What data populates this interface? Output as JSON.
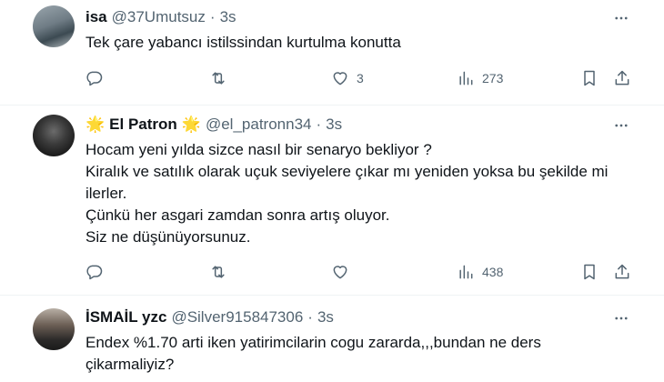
{
  "tweets": [
    {
      "name": "isa",
      "handle": "@37Umutsuz",
      "time": "3s",
      "text": "Tek çare yabancı istilssindan kurtulma konutta",
      "likes": "3",
      "views": "273"
    },
    {
      "name": "El Patron",
      "star": "🌟",
      "handle": "@el_patronn34",
      "time": "3s",
      "text": "Hocam yeni yılda sizce nasıl bir senaryo bekliyor ?\nKiralık ve satılık olarak uçuk seviyelere çıkar mı yeniden yoksa bu şekilde mi ilerler.\nÇünkü her asgari zamdan sonra artış oluyor.\nSiz ne düşünüyorsunuz.",
      "views": "438"
    },
    {
      "name": "İSMAİL yzc",
      "handle": "@Silver915847306",
      "time": "3s",
      "text": "Endex %1.70 arti iken yatirimcilarin cogu zararda,,,bundan ne ders çikarmaliyiz?"
    }
  ],
  "separator": "·",
  "icons": {
    "more": "more-horizontal-icon",
    "reply": "reply-icon",
    "retweet": "retweet-icon",
    "like": "heart-icon",
    "views": "views-bar-chart-icon",
    "bookmark": "bookmark-icon",
    "share": "share-icon"
  },
  "colors": {
    "text": "#0f1419",
    "secondary": "#536471",
    "divider": "#eff3f4",
    "star": "#f4a623"
  }
}
